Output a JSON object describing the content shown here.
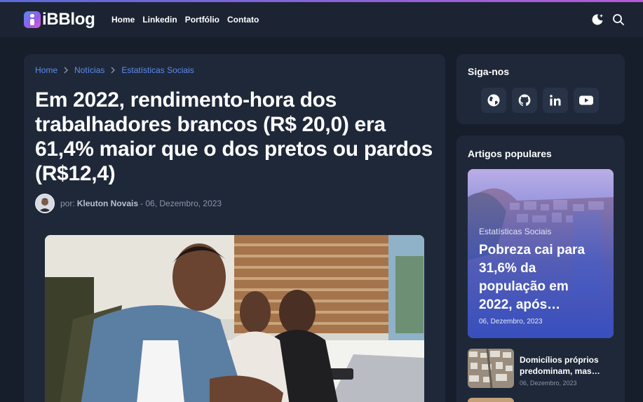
{
  "brand": {
    "name": "iBBlog"
  },
  "nav": {
    "items": [
      "Home",
      "Linkedin",
      "Portfólio",
      "Contato"
    ]
  },
  "header_icons": [
    "theme-toggle-icon",
    "search-icon"
  ],
  "breadcrumb": [
    "Home",
    "Notícias",
    "Estatísticas Sociais"
  ],
  "article": {
    "title": "Em 2022, rendimento-hora dos trabalhadores brancos (R$ 20,0) era 61,4% maior que o dos pretos ou pardos (R$12,4)",
    "by_label": "por:",
    "author": "Kleuton Novais",
    "date": "- 06, Dezembro, 2023"
  },
  "follow": {
    "title": "Siga-nos",
    "icons": [
      "globe-icon",
      "github-icon",
      "linkedin-icon",
      "youtube-icon"
    ]
  },
  "popular": {
    "title": "Artigos populares",
    "featured": {
      "category": "Estatísticas Sociais",
      "title": "Pobreza cai para 31,6% da população em 2022, após…",
      "date": "06, Dezembro, 2023"
    },
    "items": [
      {
        "title": "Domicílios próprios predominam, mas…",
        "date": "06, Dezembro, 2023"
      }
    ]
  },
  "colors": {
    "accent": "#5b8def",
    "background": "#161d2b",
    "card": "#1f2839",
    "navbar": "#1c2434"
  }
}
